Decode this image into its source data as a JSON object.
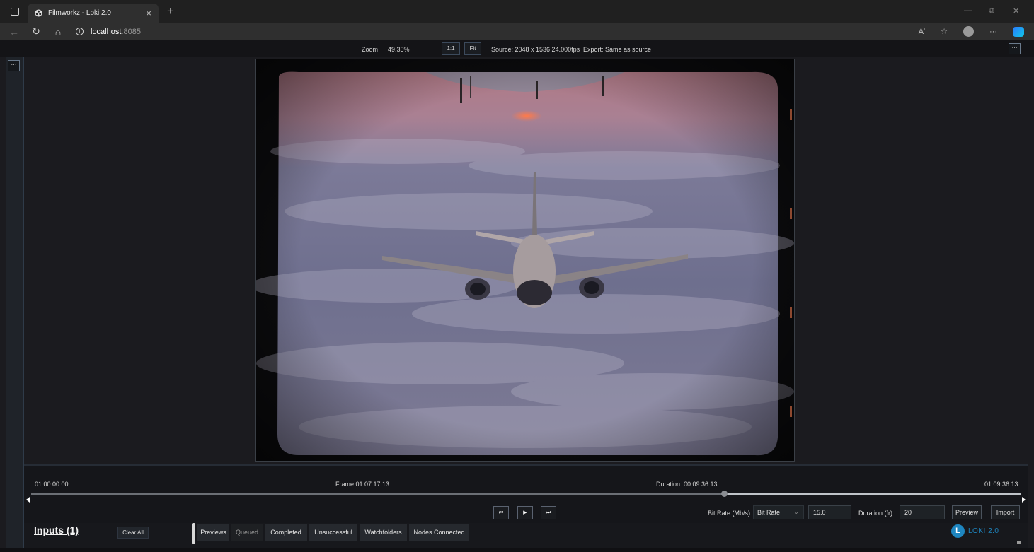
{
  "browser": {
    "tab_title": "Filmworkz - Loki 2.0",
    "tab_close": "×",
    "new_tab": "+",
    "url_host": "localhost",
    "url_port": ":8085",
    "icons": [
      "window-icon",
      "back-icon",
      "reload-icon",
      "home-icon",
      "site-info-icon",
      "read-aloud-icon",
      "favorite-icon",
      "profile-icon",
      "menu-icon",
      "copilot-icon"
    ],
    "read_aloud": "Aʹ",
    "favorite": "☆",
    "menu": "···",
    "minimize": "—",
    "restore": "⧉",
    "close": "✕"
  },
  "toolbar": {
    "zoom_label": "Zoom",
    "zoom_value": "49.35%",
    "one_to_one": "1:1",
    "fit": "Fit",
    "source_info": "Source: 2048 x 1536 24.000fps",
    "export_info": "Export: Same as source",
    "more": "···"
  },
  "sidebar": {
    "more": "···"
  },
  "timeline": {
    "start_tc": "01:00:00:00",
    "frame_tc": "Frame 01:07:17:13",
    "duration_tc": "Duration: 00:09:36:13",
    "end_tc": "01:09:36:13",
    "playhead_fraction": 0.7,
    "prev_frame": "⏮",
    "play": "▶",
    "next_frame": "⏭"
  },
  "controls": {
    "bitrate_label": "Bit Rate (Mb/s):",
    "bitrate_select": "Bit Rate",
    "bitrate_value": "15.0",
    "duration_label": "Duration (fr):",
    "duration_value": "20",
    "preview": "Preview",
    "import": "Import"
  },
  "bottom": {
    "inputs_title": "Inputs (1)",
    "clear_all": "Clear All",
    "tabs": [
      "Previews",
      "Queued",
      "Completed",
      "Unsuccessful",
      "Watchfolders",
      "Nodes Connected"
    ],
    "active_tab": "Queued",
    "logo_letter": "L",
    "logo_text": "LOKI 2.0"
  },
  "colors": {
    "accent": "#1e86c0",
    "border": "#2e3a48"
  }
}
